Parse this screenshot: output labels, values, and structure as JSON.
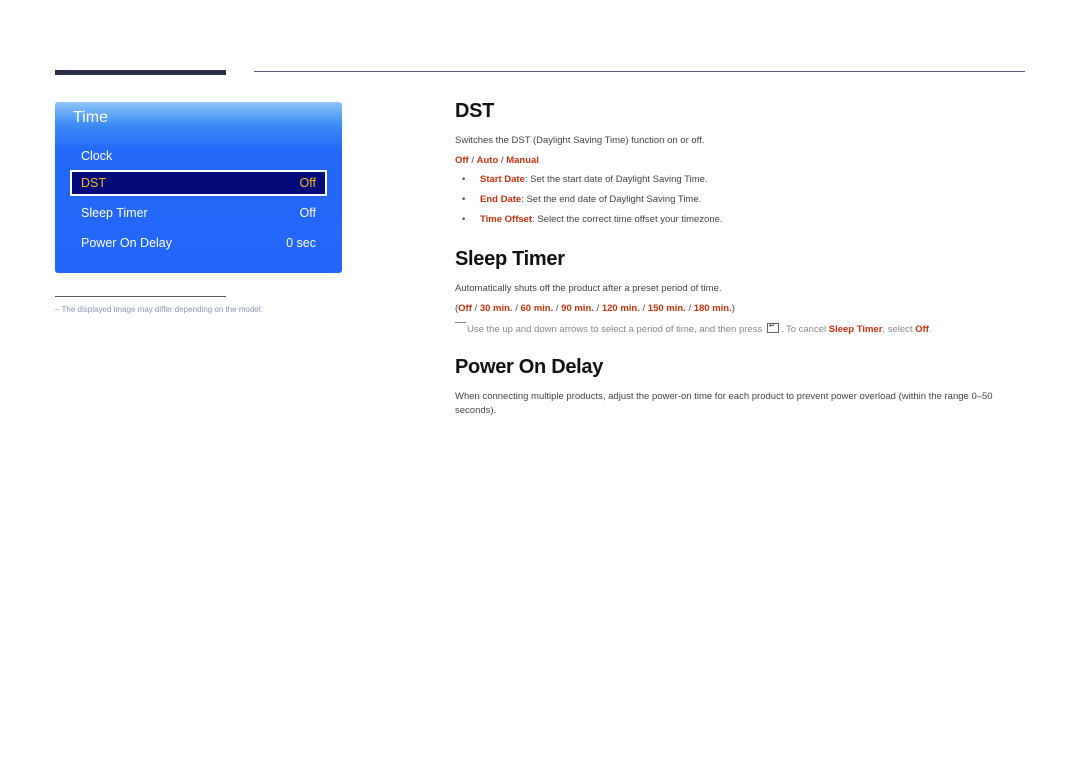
{
  "osd": {
    "title": "Time",
    "items": [
      {
        "label": "Clock",
        "value": ""
      },
      {
        "label": "DST",
        "value": "Off",
        "selected": true
      },
      {
        "label": "Sleep Timer",
        "value": "Off"
      },
      {
        "label": "Power On Delay",
        "value": "0 sec"
      }
    ]
  },
  "footnote": "–  The displayed image may differ depending on the model.",
  "sections": {
    "dst": {
      "heading": "DST",
      "description": "Switches the DST (Daylight Saving Time) function on or off.",
      "options": [
        "Off",
        "Auto",
        "Manual"
      ],
      "separator": " / ",
      "bullets": [
        {
          "term": "Start Date",
          "text": ": Set the start date of Daylight Saving Time."
        },
        {
          "term": "End Date",
          "text": ": Set the end date of Daylight Saving Time."
        },
        {
          "term": "Time Offset",
          "text": ": Select the correct time offset your timezone."
        }
      ],
      "bullet_char": "•"
    },
    "sleep_timer": {
      "heading": "Sleep Timer",
      "description": "Automatically shuts off the product after a preset period of time.",
      "open_paren": "(",
      "close_paren": ")",
      "options": [
        "Off",
        "30 min.",
        "60 min.",
        "90 min.",
        "120 min.",
        "150 min.",
        "180 min."
      ],
      "separator": " / ",
      "note_part1": "Use the up and down arrows to select a period of time, and then press ",
      "note_part2": ". To cancel ",
      "note_term1": "Sleep Timer",
      "note_part3": ", select ",
      "note_term2": "Off",
      "note_part4": "."
    },
    "power_on_delay": {
      "heading": "Power On Delay",
      "description": "When connecting multiple products, adjust the power-on time for each product to prevent power overload (within the range 0–50 seconds)."
    }
  },
  "colors": {
    "highlight": "#c8320f",
    "osd_blue": "#2366fc",
    "osd_selected_bg": "#030a7a",
    "osd_selected_text": "#f6b81c"
  }
}
